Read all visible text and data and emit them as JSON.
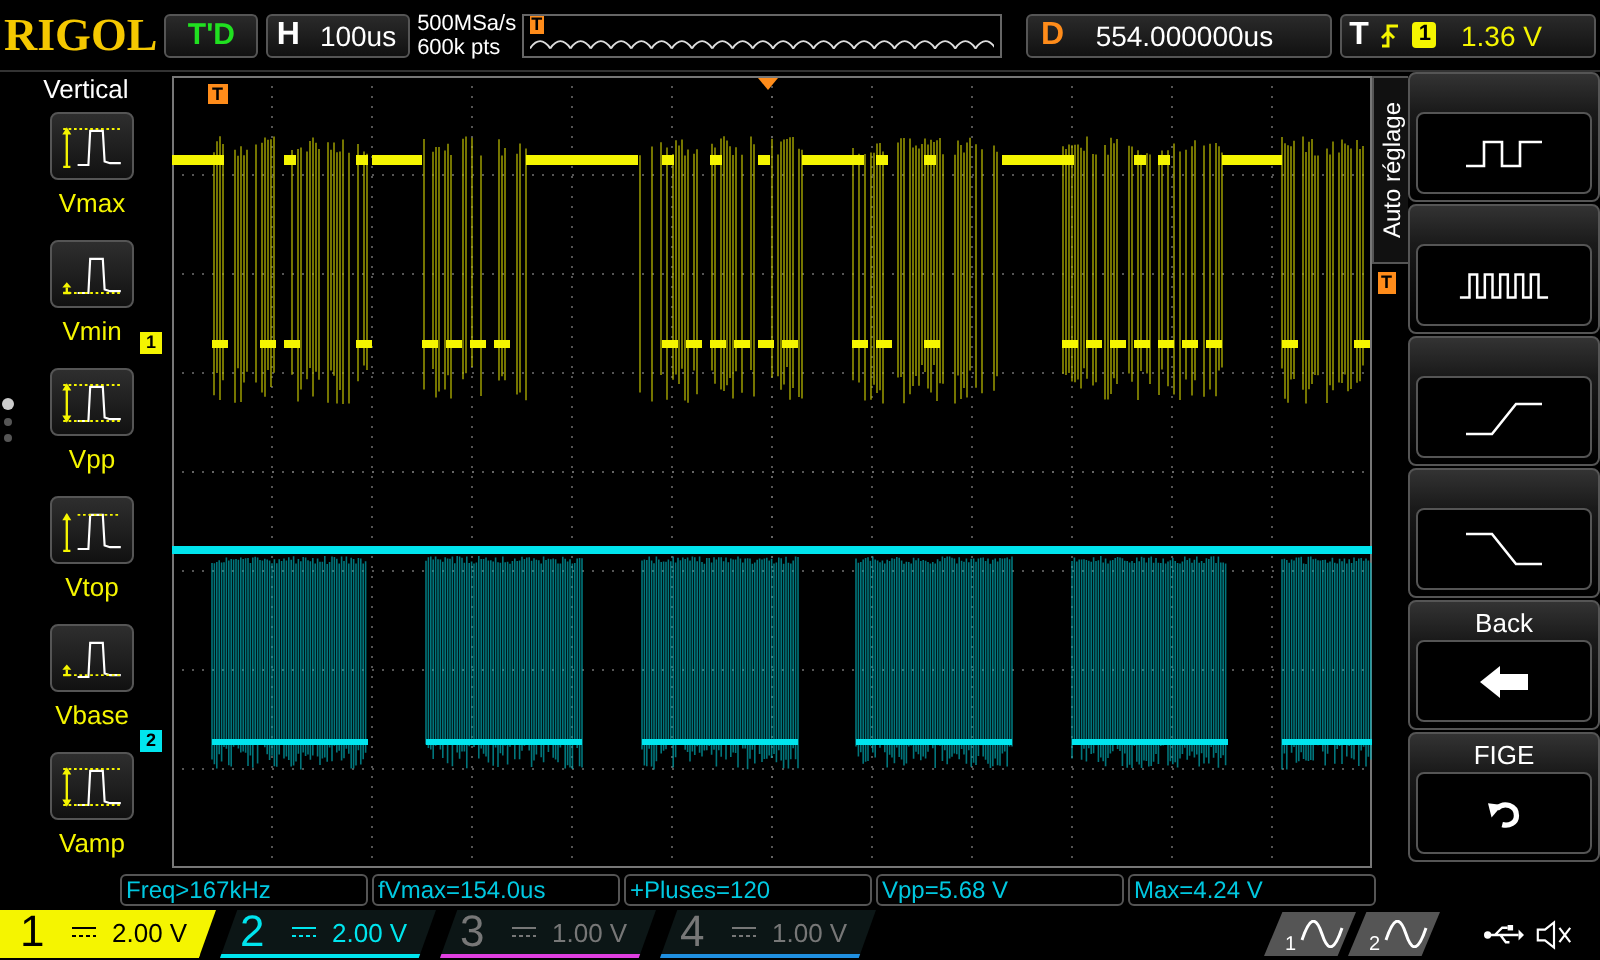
{
  "top_bar": {
    "logo": "RIGOL",
    "run_status": "T'D",
    "timebase": {
      "label": "H",
      "value": "100us"
    },
    "sample_rate": "500MSa/s",
    "memory_depth": "600k pts",
    "memory_marker": "T",
    "delay": {
      "label": "D",
      "value": "554.000000us"
    },
    "trigger": {
      "label": "T",
      "source": "1",
      "level": "1.36 V"
    }
  },
  "left_menu": {
    "title": "Vertical",
    "items": [
      {
        "label": "Vmax",
        "kind": "vmax"
      },
      {
        "label": "Vmin",
        "kind": "vmin"
      },
      {
        "label": "Vpp",
        "kind": "vpp"
      },
      {
        "label": "Vtop",
        "kind": "vtop"
      },
      {
        "label": "Vbase",
        "kind": "vbase"
      },
      {
        "label": "Vamp",
        "kind": "vamp"
      }
    ],
    "pages": [
      {
        "selected": true
      },
      {
        "selected": false
      },
      {
        "selected": false
      }
    ]
  },
  "plot": {
    "trigger_position_marker": "T",
    "trigger_level_marker": "T",
    "channel_markers": [
      {
        "label": "1",
        "color": "#f5f500"
      },
      {
        "label": "2",
        "color": "#00e5ee"
      }
    ]
  },
  "right_menu": {
    "side_tab": "Auto réglage",
    "buttons": [
      {
        "kind": "square-wave"
      },
      {
        "kind": "pulse-train"
      },
      {
        "kind": "rising-edge"
      },
      {
        "kind": "falling-edge"
      },
      {
        "label": "Back",
        "kind": "back"
      },
      {
        "label": "FIGE",
        "kind": "undo"
      }
    ]
  },
  "measurements": [
    "Freq>167kHz",
    "fVmax=154.0us",
    "+Pluses=120",
    "Vpp=5.68 V",
    "Max=4.24 V"
  ],
  "channels": [
    {
      "number": "1",
      "scale": "2.00 V",
      "on": true,
      "selected": true,
      "color": "#f5f500"
    },
    {
      "number": "2",
      "scale": "2.00 V",
      "on": true,
      "selected": false,
      "color": "#00e5ee"
    },
    {
      "number": "3",
      "scale": "1.00 V",
      "on": false,
      "selected": false,
      "color": "#e040e0"
    },
    {
      "number": "4",
      "scale": "1.00 V",
      "on": false,
      "selected": false,
      "color": "#2090e0"
    }
  ],
  "generators": [
    {
      "label": "1"
    },
    {
      "label": "2"
    }
  ]
}
